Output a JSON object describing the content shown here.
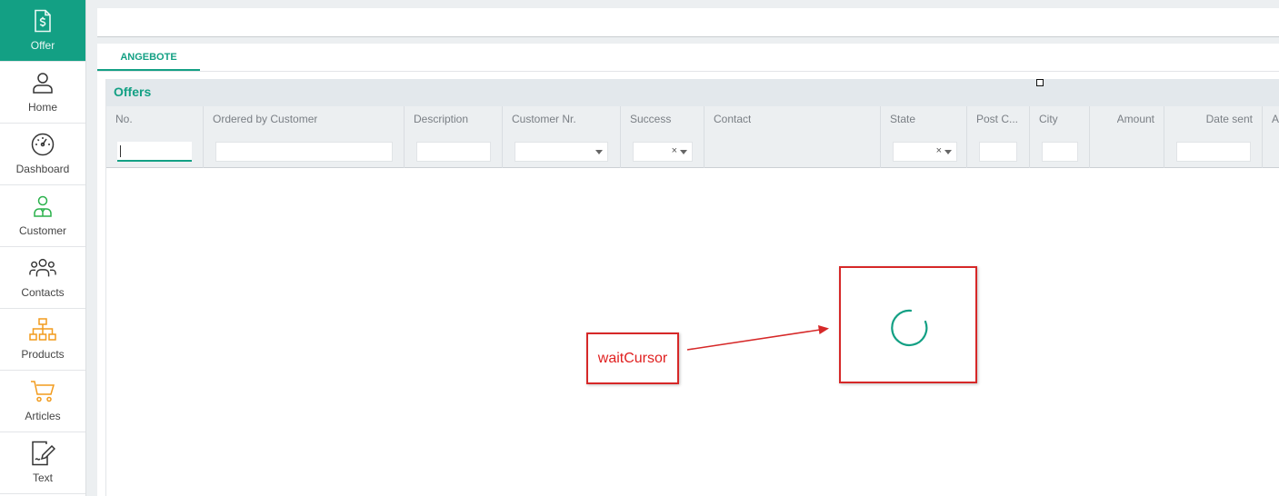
{
  "sidebar": {
    "items": [
      {
        "label": "Offer",
        "icon": "offer-document-icon",
        "active": true
      },
      {
        "label": "Home",
        "icon": "person-icon"
      },
      {
        "label": "Dashboard",
        "icon": "gauge-icon"
      },
      {
        "label": "Customer",
        "icon": "customer-icon"
      },
      {
        "label": "Contacts",
        "icon": "group-icon"
      },
      {
        "label": "Products",
        "icon": "hierarchy-icon"
      },
      {
        "label": "Articles",
        "icon": "cart-icon"
      },
      {
        "label": "Text",
        "icon": "edit-document-icon"
      }
    ]
  },
  "tabs": [
    {
      "label": "ANGEBOTE",
      "active": true
    }
  ],
  "grid": {
    "title": "Offers",
    "columns": [
      {
        "name": "No.",
        "filter": "text-focused"
      },
      {
        "name": "Ordered by Customer",
        "filter": "text"
      },
      {
        "name": "Description",
        "filter": "text"
      },
      {
        "name": "Customer Nr.",
        "filter": "dropdown"
      },
      {
        "name": "Success",
        "filter": "clearable-dropdown"
      },
      {
        "name": "Contact",
        "filter": "none"
      },
      {
        "name": "State",
        "filter": "clearable-dropdown"
      },
      {
        "name": "Post C...",
        "filter": "text"
      },
      {
        "name": "City",
        "filter": "text"
      },
      {
        "name": "Amount",
        "filter": "none"
      },
      {
        "name": "Date sent",
        "filter": "text"
      },
      {
        "name": "A",
        "filter": "none"
      }
    ],
    "clear_symbol": "×"
  },
  "annotation": {
    "label": "waitCursor",
    "color": "#d62828",
    "spinner_color": "#13a084"
  },
  "colors": {
    "accent": "#13a084",
    "background": "#eceff1"
  }
}
